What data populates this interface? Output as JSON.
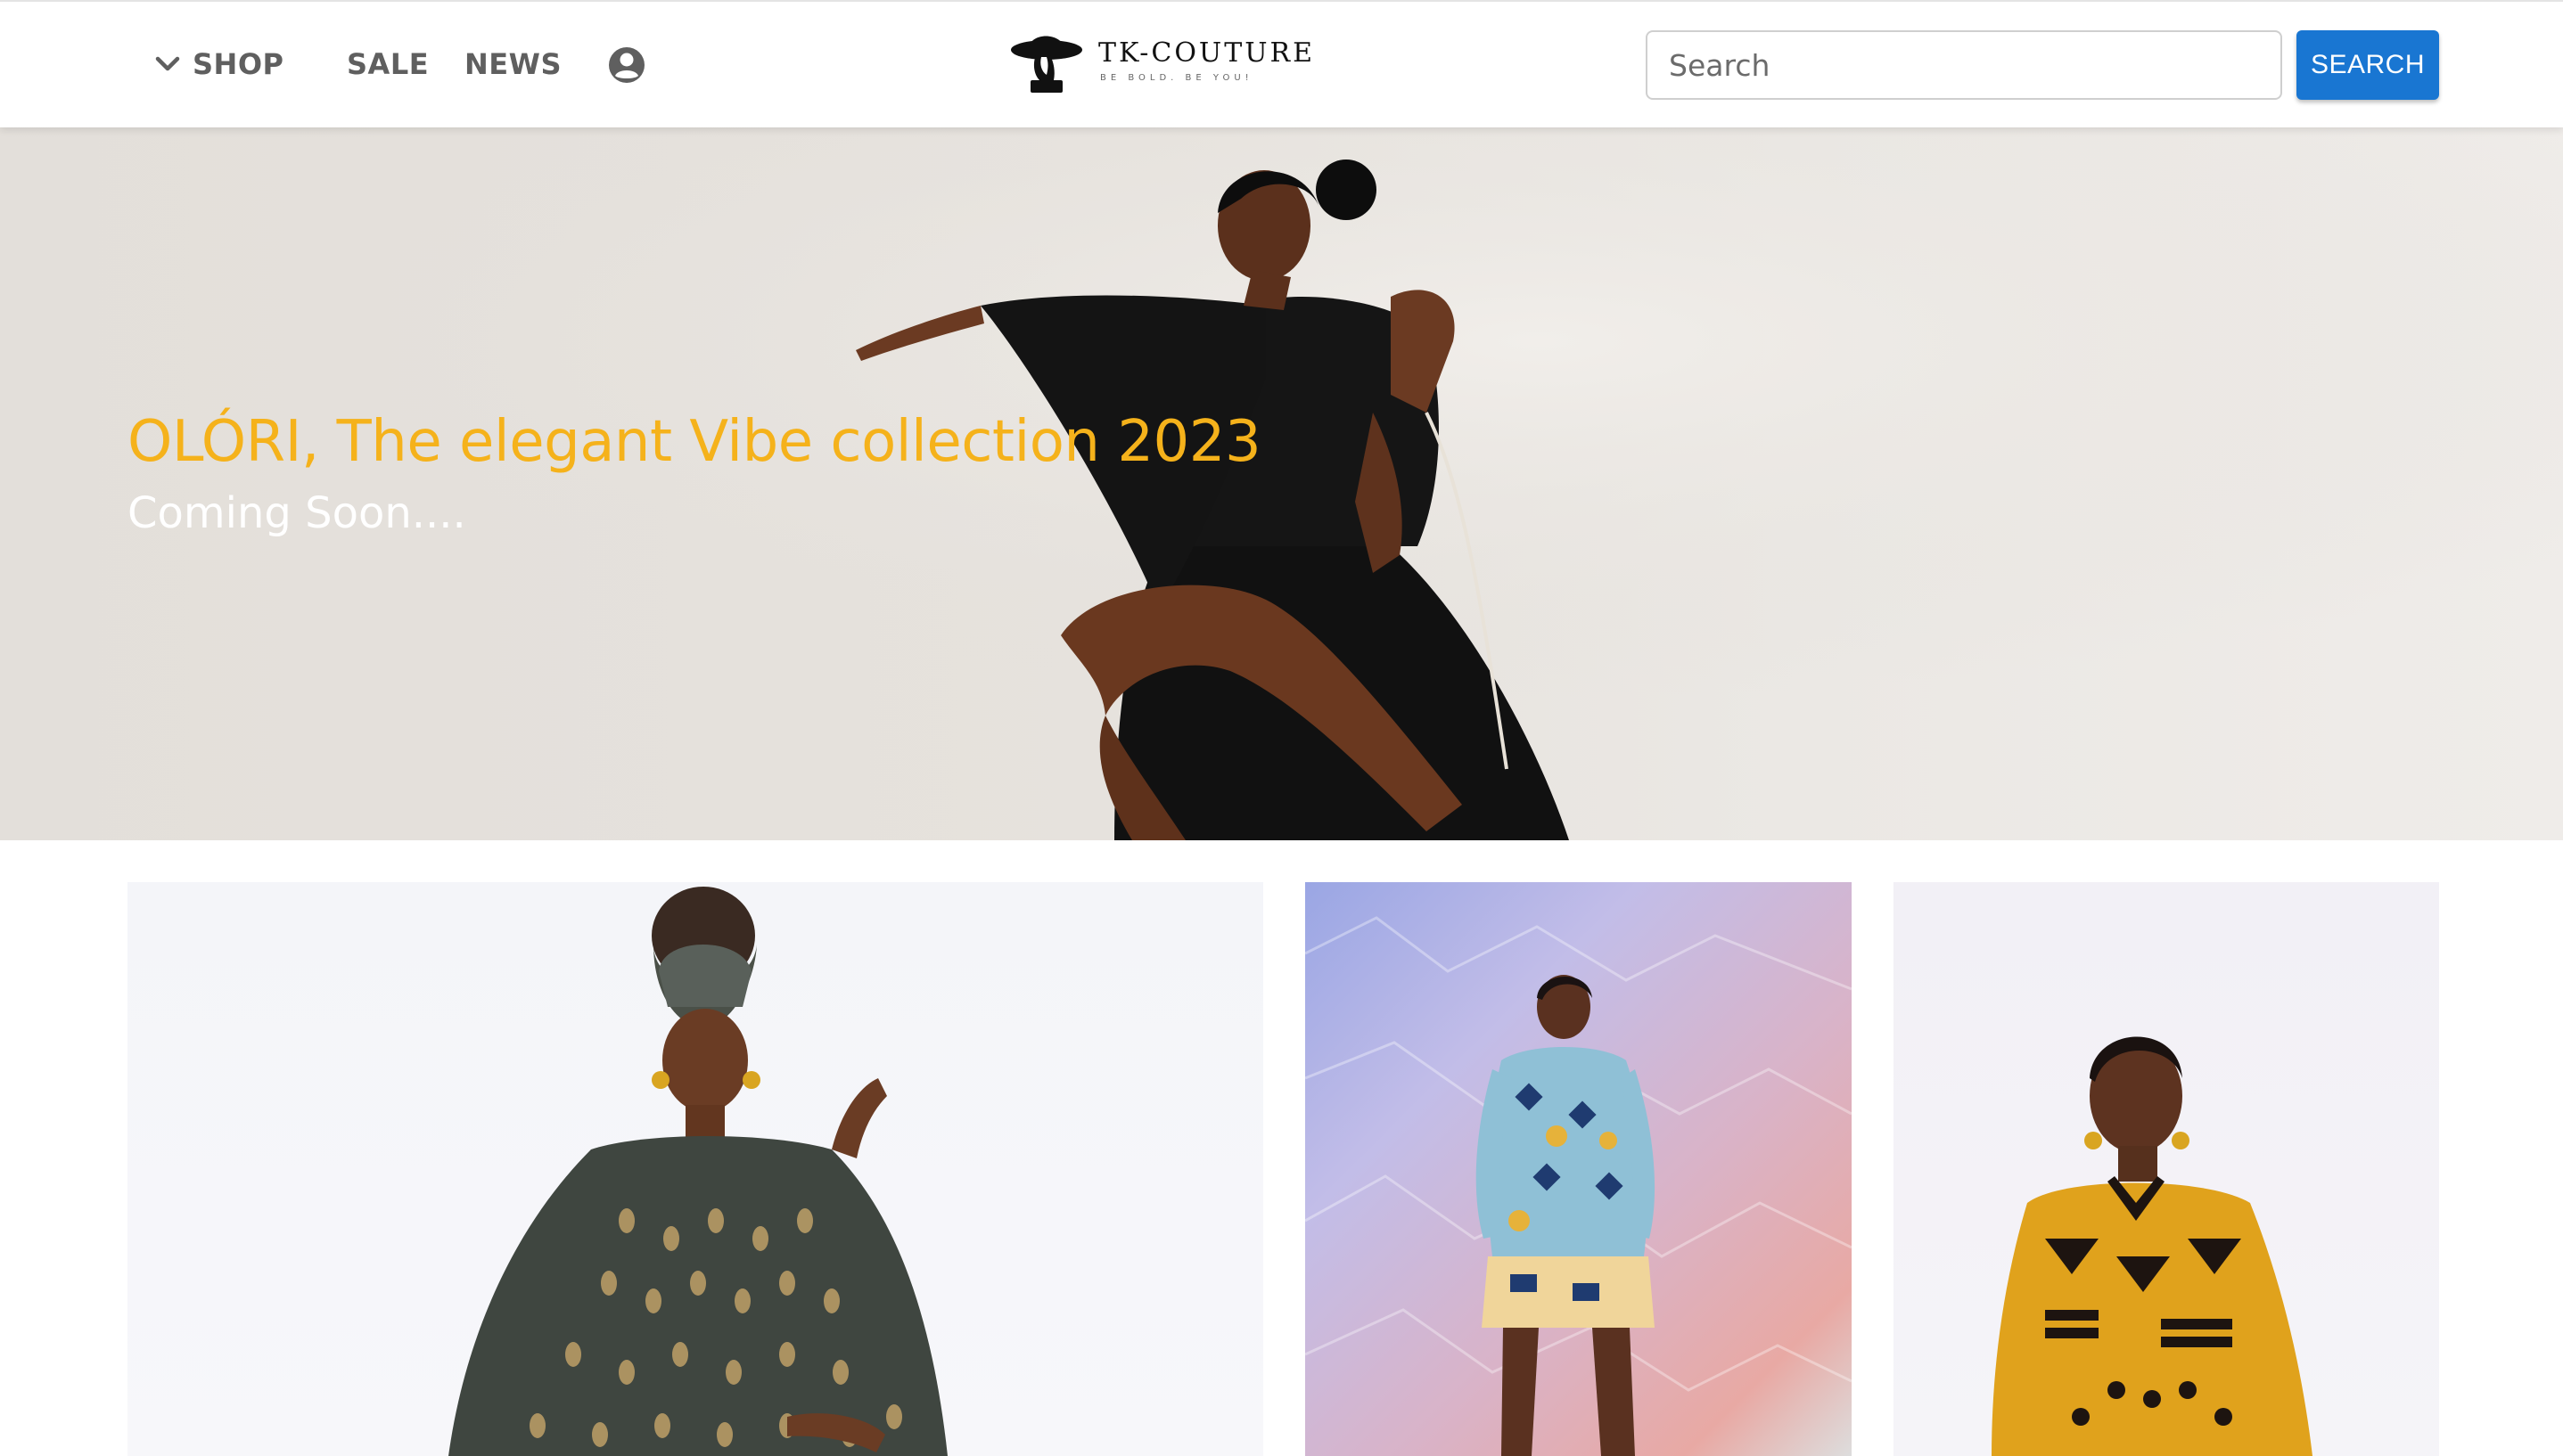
{
  "header": {
    "nav": {
      "shop_label": "SHOP",
      "sale_label": "SALE",
      "news_label": "NEWS"
    },
    "icons": {
      "shop_chevron": "chevron-down-icon",
      "account": "account-circle-icon"
    },
    "logo": {
      "brand_name": "TK-COUTURE",
      "tagline": "BE BOLD. BE YOU!"
    },
    "search": {
      "placeholder": "Search",
      "button_label": "SEARCH"
    }
  },
  "hero": {
    "title": "OLÓRI, The elegant Vibe collection 2023",
    "subtitle": "Coming Soon...."
  },
  "products": [
    {
      "image": "model in dark sheer peacock-print kaftan with head wrap"
    },
    {
      "image": "model in geometric print top and skirt set on metallic backdrop"
    },
    {
      "image": "model in yellow and black print shirt"
    }
  ],
  "colors": {
    "accent_title": "#f5b21b",
    "search_button": "#1976d2",
    "nav_text": "#5f5f5f"
  }
}
